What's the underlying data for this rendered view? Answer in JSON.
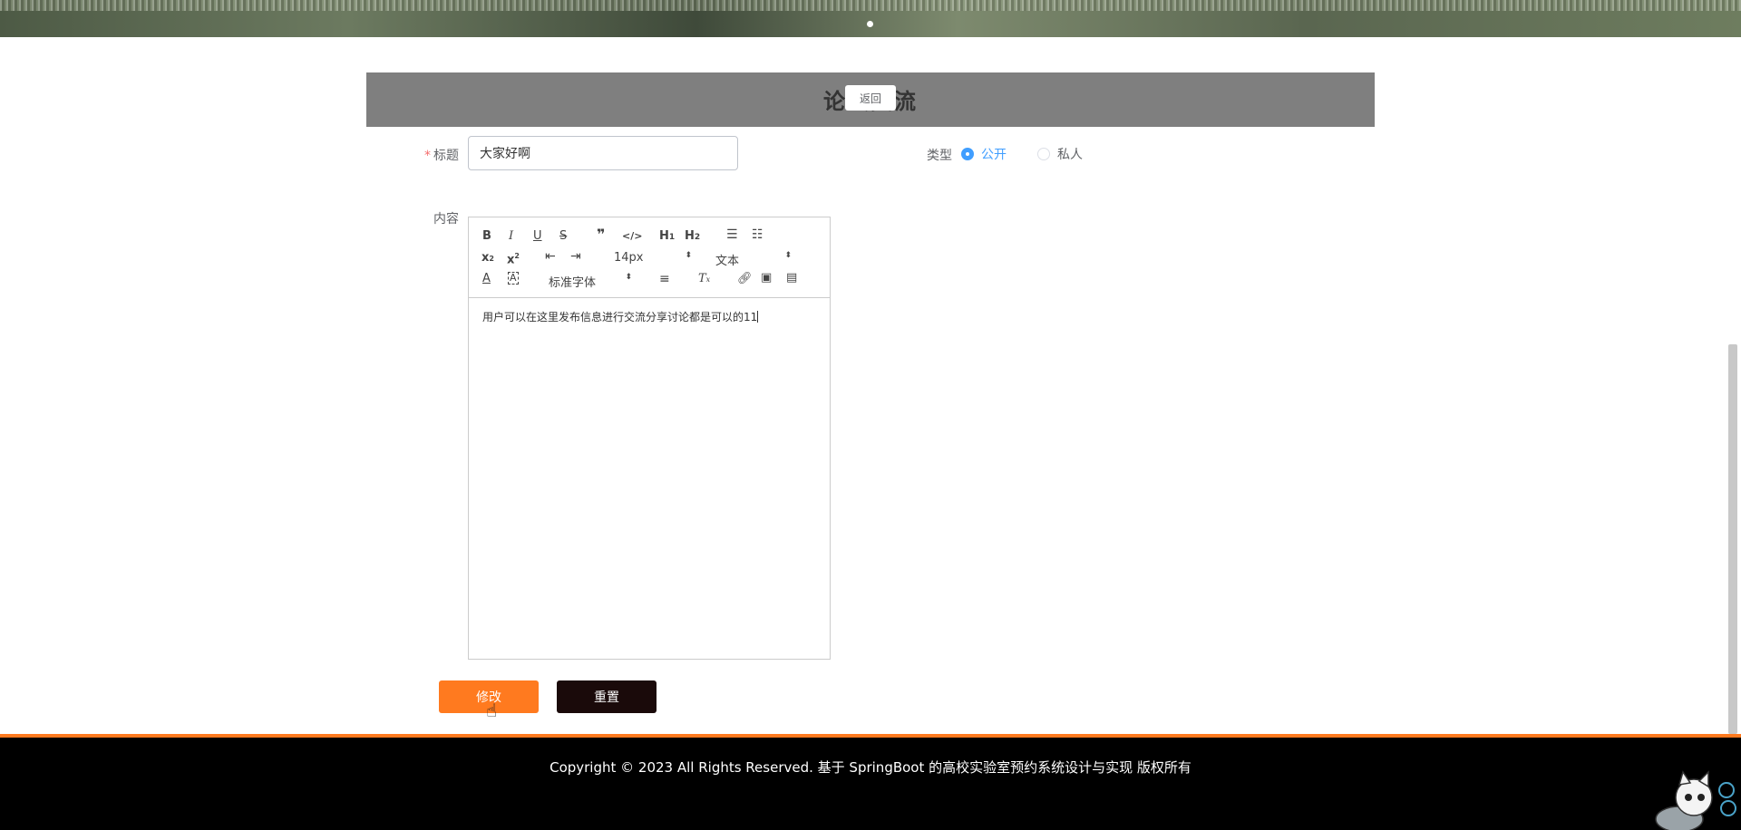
{
  "page": {
    "title": "论坛交流",
    "back_label": "返回"
  },
  "form": {
    "title_label": "标题",
    "title_value": "大家好啊",
    "type_label": "类型",
    "type_options": [
      "公开",
      "私人"
    ],
    "type_selected": "公开",
    "content_label": "内容"
  },
  "editor": {
    "toolbar": {
      "font_size": "14px",
      "block_type": "文本",
      "font_family": "标准字体"
    },
    "content": "用户可以在这里发布信息进行交流分享讨论都是可以的11"
  },
  "actions": {
    "update_label": "修改",
    "reset_label": "重置"
  },
  "footer": {
    "copyright": "Copyright © 2023 All Rights Reserved. 基于 SpringBoot 的高校实验室预约系统设计与实现 版权所有"
  },
  "colors": {
    "accent": "#ff7a1f",
    "primary": "#409eff",
    "title_bar": "#7f7f7f",
    "footer_bg": "#000000"
  }
}
